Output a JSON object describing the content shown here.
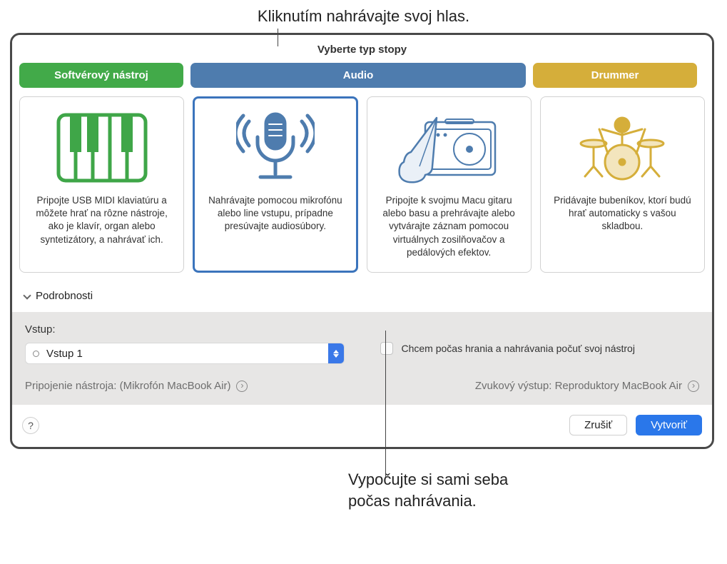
{
  "callouts": {
    "top": "Kliknutím nahrávajte svoj hlas.",
    "bottom_line1": "Vypočujte si sami seba",
    "bottom_line2": "počas nahrávania."
  },
  "dialog": {
    "title": "Vyberte typ stopy",
    "tabs": {
      "software": "Softvérový nástroj",
      "audio": "Audio",
      "drummer": "Drummer"
    },
    "cards": {
      "instrument": "Pripojte USB MIDI klaviatúru a môžete hrať na rôzne nástroje, ako je klavír, organ alebo syntetizátory, a nahrávať ich.",
      "microphone": "Nahrávajte pomocou mikrofónu alebo line vstupu, prípadne presúvajte audiosúbory.",
      "guitar": "Pripojte k svojmu Macu gitaru alebo basu a prehrávajte alebo vytvárajte záznam pomocou virtuálnych zosilňovačov a pedálových efektov.",
      "drummer": "Pridávajte bubeníkov, ktorí budú hrať automaticky s vašou skladbou."
    },
    "details_label": "Podrobnosti",
    "input_label": "Vstup:",
    "input_value": "Vstup 1",
    "monitor_label": "Chcem počas hrania a nahrávania počuť svoj nástroj",
    "connection_text": "Pripojenie nástroja: (Mikrofón MacBook Air)",
    "output_text": "Zvukový výstup: Reproduktory MacBook Air",
    "help_label": "?",
    "cancel_label": "Zrušiť",
    "create_label": "Vytvoriť"
  }
}
